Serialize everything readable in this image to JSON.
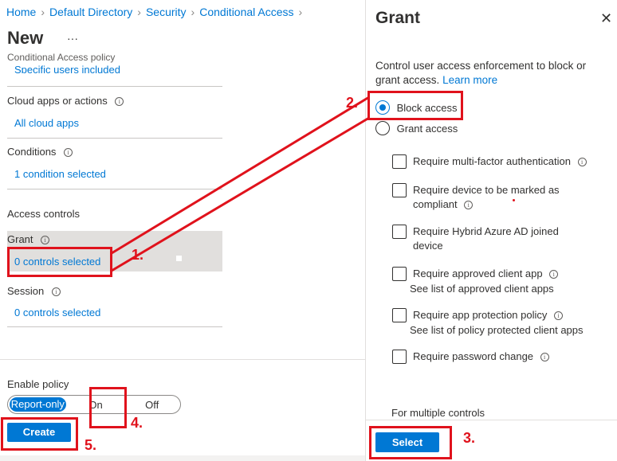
{
  "breadcrumb": {
    "items": [
      "Home",
      "Default Directory",
      "Security",
      "Conditional Access"
    ]
  },
  "left": {
    "title": "New",
    "more": "···",
    "subtitle": "Conditional Access policy",
    "users_value": "Specific users included",
    "cloud_apps_label": "Cloud apps or actions",
    "cloud_apps_value": "All cloud apps",
    "conditions_label": "Conditions",
    "conditions_value": "1 condition selected",
    "access_controls_label": "Access controls",
    "grant_label": "Grant",
    "grant_value": "0 controls selected",
    "session_label": "Session",
    "session_value": "0 controls selected",
    "enable_policy_label": "Enable policy",
    "toggle_options": [
      "Report-only",
      "On",
      "Off"
    ],
    "toggle_selected": "Report-only",
    "create_label": "Create"
  },
  "right": {
    "title": "Grant",
    "close_icon": "close-icon",
    "description": "Control user access enforcement to block or grant access.",
    "learn_more": "Learn more",
    "block_access_label": "Block access",
    "grant_access_label": "Grant access",
    "selected_option": "Block access",
    "controls": [
      {
        "label": "Require multi-factor authentication"
      },
      {
        "label": "Require device to be marked as",
        "label2": "compliant"
      },
      {
        "label": "Require Hybrid Azure AD joined",
        "label2": "device"
      },
      {
        "label": "Require approved client app",
        "link": "See list of approved client apps"
      },
      {
        "label": "Require app protection policy",
        "link": "See list of policy protected client apps"
      },
      {
        "label": "Require password change"
      }
    ],
    "multiple_controls_label": "For multiple controls",
    "select_label": "Select"
  },
  "annotations": {
    "n1": "1.",
    "n2": "2.",
    "n3": "3.",
    "n4": "4.",
    "n5": "5.",
    "color": "#e0121c"
  },
  "colors": {
    "accent": "#0078d4",
    "grant_row_bg": "#e1dfdd"
  }
}
